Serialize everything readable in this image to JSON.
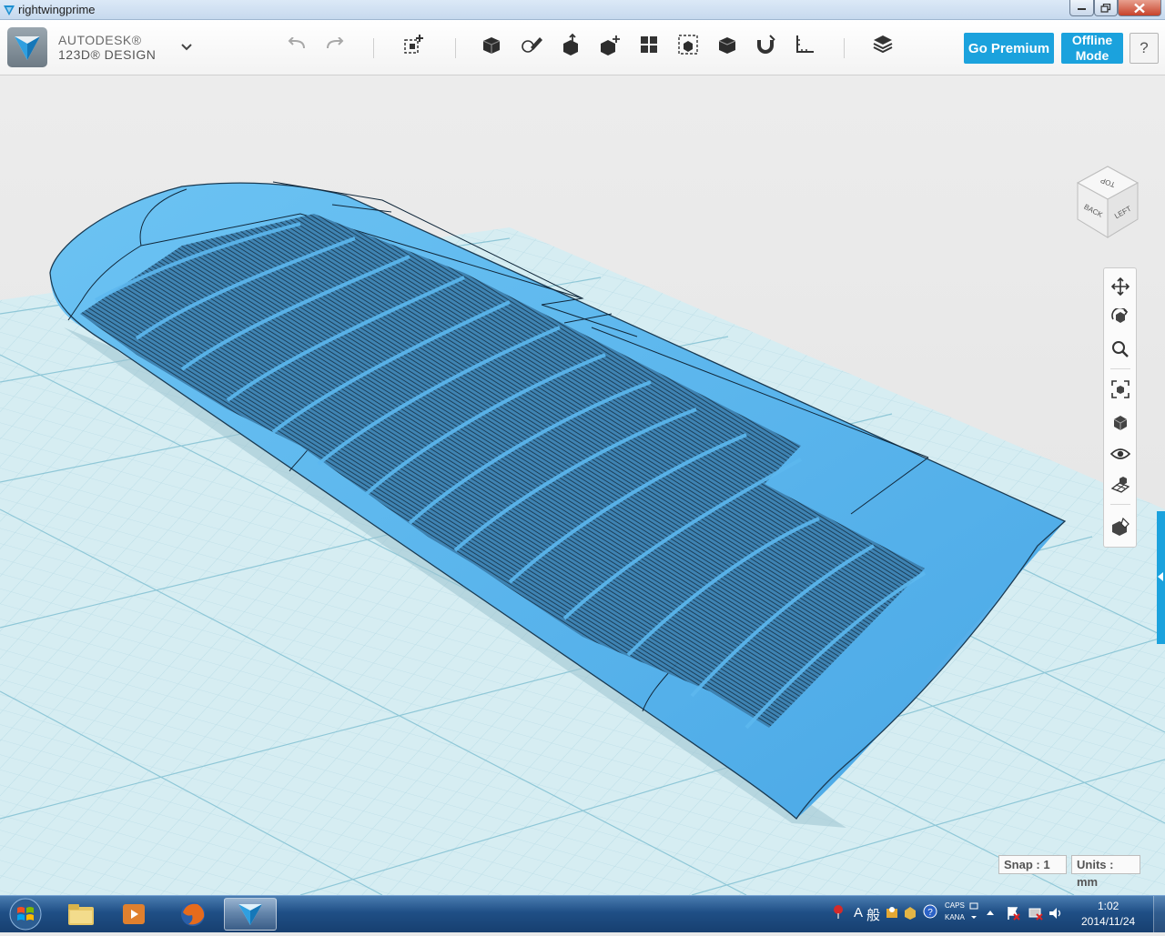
{
  "window": {
    "title": "rightwingprime"
  },
  "toolbar": {
    "brand_line1": "AUTODESK®",
    "brand_line2": "123D® DESIGN",
    "main_menu_icon": "chevron-down-icon",
    "undo_icon": "undo-icon",
    "redo_icon": "redo-icon",
    "tools": [
      "transform",
      "primitives",
      "sketch",
      "construct",
      "modify",
      "pattern",
      "grouping",
      "combine",
      "measure",
      "snap",
      "material",
      "text"
    ],
    "go_premium_label": "Go Premium",
    "offline_line1": "Offline",
    "offline_line2": "Mode",
    "help_label": "?",
    "accent_color": "#1ba2dd"
  },
  "viewcube": {
    "top": "TOP",
    "back": "BACK",
    "left": "LEFT"
  },
  "navbar": {
    "items": [
      "pan",
      "orbit",
      "zoom",
      "fit",
      "view-modes",
      "visibility",
      "grid-toggle",
      "materials"
    ]
  },
  "status": {
    "snap": "Snap : 1",
    "units": "Units : mm"
  },
  "model": {
    "name": "rightwingprime",
    "color": "#5db8ef"
  },
  "taskbar": {
    "apps": [
      "explorer",
      "media-player",
      "firefox",
      "123d-design"
    ],
    "ime_mode": "A",
    "ime_label": "般",
    "caps": "CAPS",
    "kana": "KANA",
    "time": "1:02",
    "date": "2014/11/24"
  }
}
